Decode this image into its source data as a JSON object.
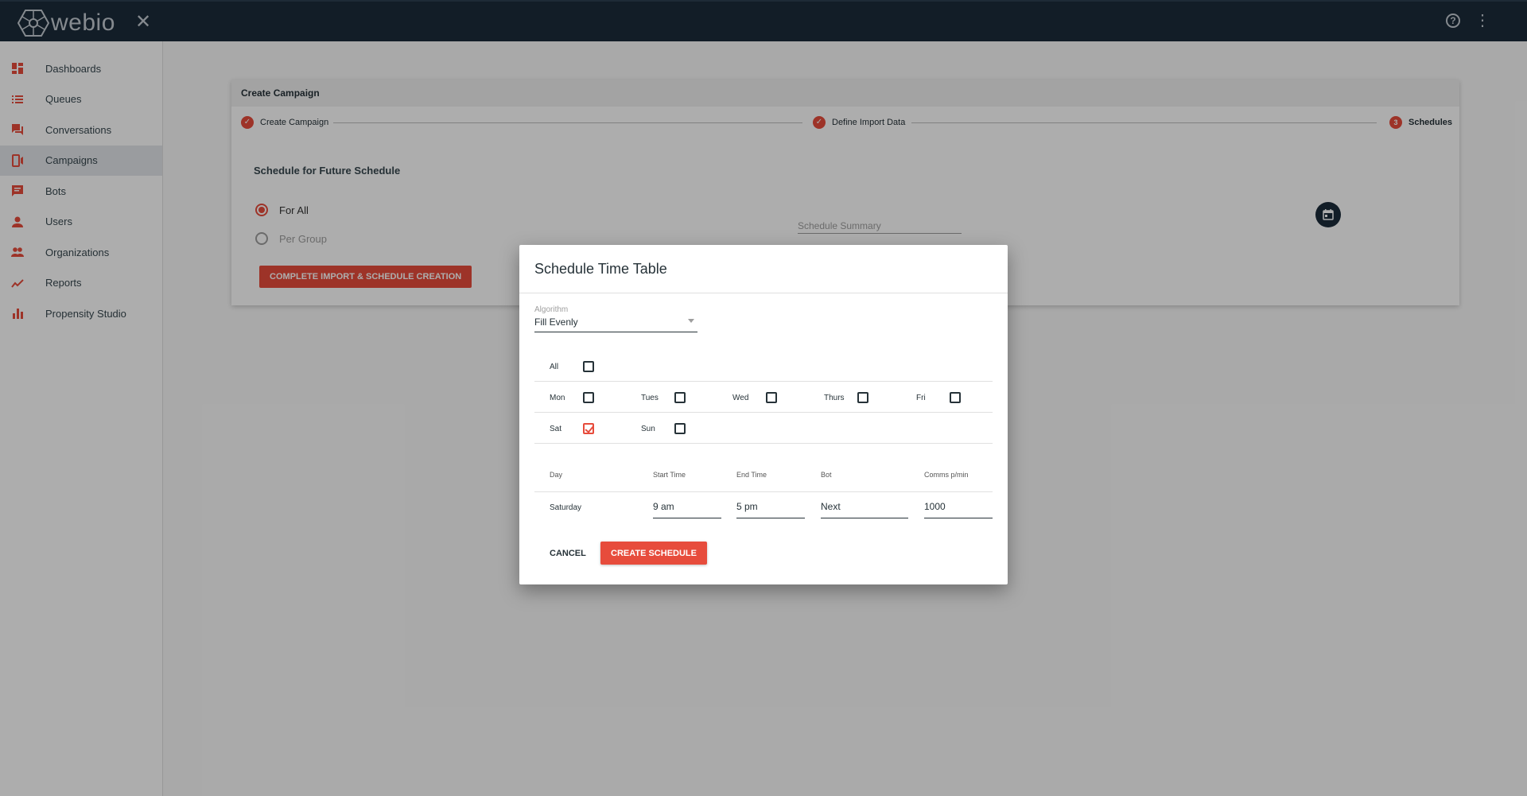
{
  "app": {
    "logo_text": "webio"
  },
  "topbar": {
    "close_glyph": "✕",
    "help_glyph": "?",
    "more_glyph": "⋮"
  },
  "sidebar": {
    "items": [
      {
        "label": "Dashboards",
        "icon": "dashboard-icon"
      },
      {
        "label": "Queues",
        "icon": "list-icon"
      },
      {
        "label": "Conversations",
        "icon": "chat-icon"
      },
      {
        "label": "Campaigns",
        "icon": "campaign-icon",
        "active": true
      },
      {
        "label": "Bots",
        "icon": "bot-icon"
      },
      {
        "label": "Users",
        "icon": "user-icon"
      },
      {
        "label": "Organizations",
        "icon": "people-icon"
      },
      {
        "label": "Reports",
        "icon": "trend-icon"
      },
      {
        "label": "Propensity Studio",
        "icon": "bar-chart-icon"
      }
    ]
  },
  "campaign": {
    "header": "Create Campaign",
    "steps": [
      {
        "label": "Create Campaign",
        "state": "done"
      },
      {
        "label": "Define Import Data",
        "state": "done"
      },
      {
        "label": "Schedules",
        "state": "active",
        "number": "3"
      }
    ],
    "future_title": "Schedule for Future Schedule",
    "radio_all": "For All",
    "radio_group": "Per Group",
    "summary_placeholder": "Schedule Summary",
    "complete_button": "COMPLETE IMPORT & SCHEDULE CREATION"
  },
  "dialog": {
    "title": "Schedule Time Table",
    "algorithm_label": "Algorithm",
    "algorithm_value": "Fill Evenly",
    "days": {
      "all": {
        "label": "All",
        "checked": false
      },
      "mon": {
        "label": "Mon",
        "checked": false
      },
      "tues": {
        "label": "Tues",
        "checked": false
      },
      "wed": {
        "label": "Wed",
        "checked": false
      },
      "thurs": {
        "label": "Thurs",
        "checked": false
      },
      "fri": {
        "label": "Fri",
        "checked": false
      },
      "sat": {
        "label": "Sat",
        "checked": true
      },
      "sun": {
        "label": "Sun",
        "checked": false
      }
    },
    "table": {
      "headers": {
        "day": "Day",
        "start": "Start Time",
        "end": "End Time",
        "bot": "Bot",
        "comms": "Comms p/min"
      },
      "row": {
        "day": "Saturday",
        "start": "9 am",
        "end": "5 pm",
        "bot": "Next",
        "comms": "1000"
      }
    },
    "cancel_button": "CANCEL",
    "create_button": "CREATE SCHEDULE"
  },
  "colors": {
    "accent": "#e74c3c",
    "topbar": "#1b2b3a"
  }
}
